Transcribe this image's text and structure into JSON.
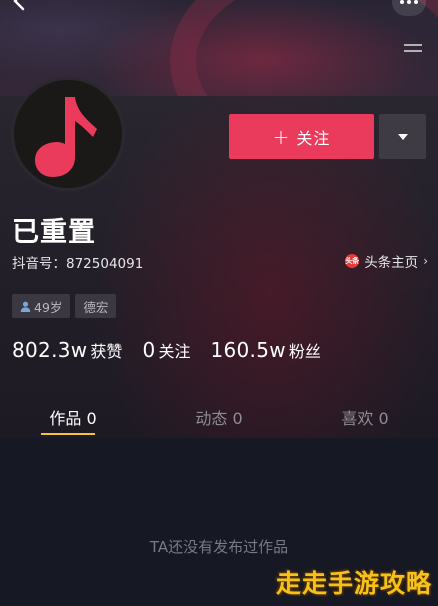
{
  "profile": {
    "username": "已重置",
    "douyin_id": "抖音号：872504091",
    "toutiao_link": "头条主页",
    "toutiao_icon_text": "头条",
    "avatar_icon": "music-note-icon",
    "tags": [
      "49岁",
      "德宏"
    ]
  },
  "actions": {
    "follow_plus": "+",
    "follow_label": "关注"
  },
  "stats": [
    {
      "value": "802.3w",
      "label": "获赞"
    },
    {
      "value": "0",
      "label": "关注"
    },
    {
      "value": "160.5w",
      "label": "粉丝"
    }
  ],
  "tabs": [
    {
      "label": "作品 0"
    },
    {
      "label": "动态 0"
    },
    {
      "label": "喜欢 0"
    }
  ],
  "empty_message": "TA还没有发布过作品",
  "watermark": "走走手游攻略",
  "colors": {
    "accent": "#ea3b5d",
    "tab_indicator": "#f5c343",
    "watermark": "#f4c21a"
  }
}
